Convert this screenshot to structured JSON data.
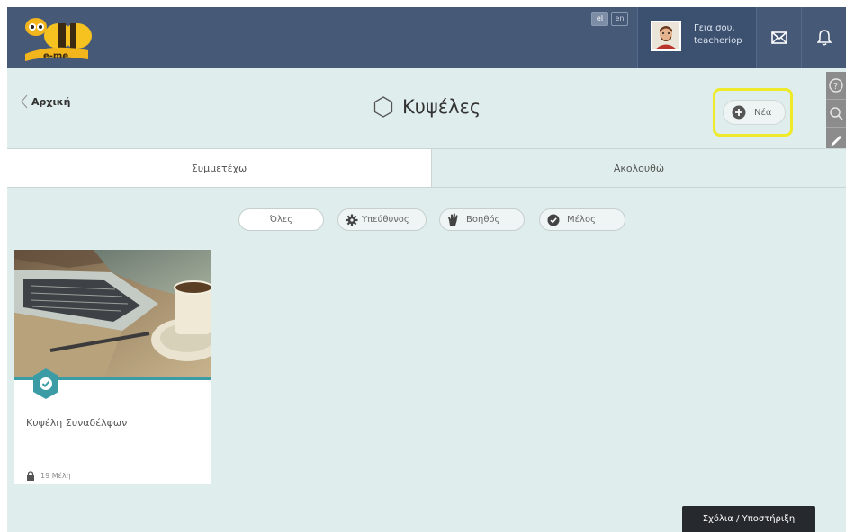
{
  "header": {
    "logo_text": "e-me",
    "languages": [
      {
        "code": "el",
        "active": true
      },
      {
        "code": "en",
        "active": false
      }
    ],
    "greeting_line1": "Γεια σου,",
    "username": "teacheriop",
    "icons": {
      "messages": "envelope-icon",
      "notifications": "bell-icon"
    }
  },
  "side_tools": [
    "help-icon",
    "search-icon",
    "pencil-icon"
  ],
  "page": {
    "back_label": "Αρχική",
    "title": "Κυψέλες",
    "new_button_label": "Νέα"
  },
  "tabs": [
    {
      "label": "Συμμετέχω",
      "active": true
    },
    {
      "label": "Ακολουθώ",
      "active": false
    }
  ],
  "filters": [
    {
      "label": "Όλες",
      "icon": "",
      "active": true
    },
    {
      "label": "Υπεύθυνος",
      "icon": "gear-icon",
      "active": false
    },
    {
      "label": "Βοηθός",
      "icon": "hand-icon",
      "active": false
    },
    {
      "label": "Μέλος",
      "icon": "check-circle-icon",
      "active": false
    }
  ],
  "hives": [
    {
      "title": "Κυψέλη Συναδέλφων",
      "members": "19 Μέλη",
      "badge_icon": "check-hexagon-icon",
      "lock_icon": "lock-icon"
    }
  ],
  "feedback_label": "Σχόλια / Υποστήριξη",
  "colors": {
    "topbar": "#465a78",
    "background": "#dfeeec",
    "accent_teal": "#3c9ca6",
    "highlight_yellow": "#eeea2a"
  }
}
